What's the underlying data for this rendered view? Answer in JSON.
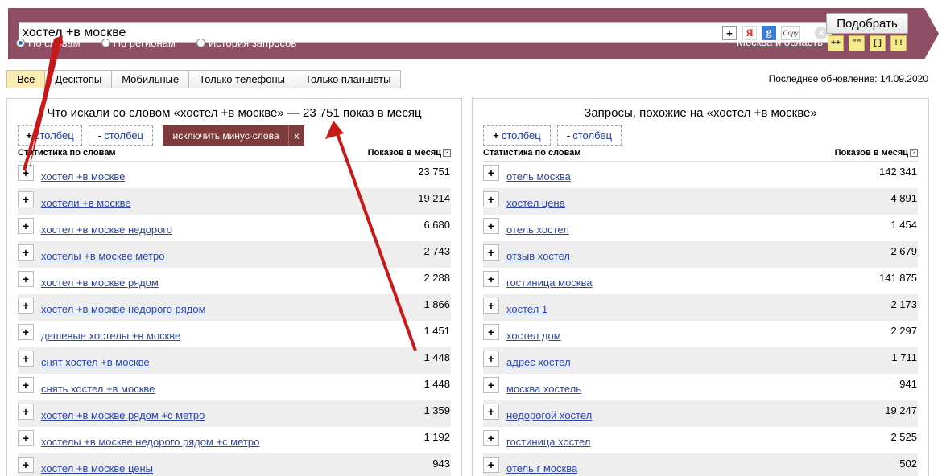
{
  "search": {
    "query": "хостел +в москве",
    "submit_label": "Подобрать",
    "ya_label": "Я",
    "g_label": "g",
    "copy_label": "Copy",
    "add_label": "+"
  },
  "modes": {
    "by_words": "По словам",
    "by_regions": "По регионам",
    "history": "История запросов"
  },
  "region": "Москва и область",
  "operators": [
    "++",
    "\"\"",
    "[]",
    "!!"
  ],
  "tabs": [
    "Все",
    "Десктопы",
    "Мобильные",
    "Только телефоны",
    "Только планшеты"
  ],
  "last_update": "Последнее обновление: 14.09.2020",
  "left": {
    "title": "Что искали со словом «хостел +в москве» — 23 751 показ в месяц",
    "add_col": "столбец",
    "remove_col": "столбец",
    "exclude_btn": "исключить минус-слова",
    "close_btn": "x",
    "col_words": "Статистика по словам",
    "col_shows": "Показов в месяц",
    "rows": [
      {
        "kw": "хостел +в москве",
        "count": "23 751"
      },
      {
        "kw": "хостели +в москве",
        "count": "19 214"
      },
      {
        "kw": "хостел +в москве недорого",
        "count": "6 680"
      },
      {
        "kw": "хостелы +в москве метро",
        "count": "2 743"
      },
      {
        "kw": "хостел +в москве рядом",
        "count": "2 288"
      },
      {
        "kw": "хостел +в москве недорого рядом",
        "count": "1 866"
      },
      {
        "kw": "дешевые хостелы +в москве",
        "count": "1 451"
      },
      {
        "kw": "снят хостел +в москве",
        "count": "1 448"
      },
      {
        "kw": "снять хостел +в москве",
        "count": "1 448"
      },
      {
        "kw": "хостел +в москве рядом +с метро",
        "count": "1 359"
      },
      {
        "kw": "хостелы +в москве недорого рядом +с метро",
        "count": "1 192"
      },
      {
        "kw": "хостел +в москве цены",
        "count": "943"
      }
    ]
  },
  "right": {
    "title": "Запросы, похожие на «хостел +в москве»",
    "add_col": "столбец",
    "remove_col": "столбец",
    "col_words": "Статистика по словам",
    "col_shows": "Показов в месяц",
    "rows": [
      {
        "kw": "отель москва",
        "count": "142 341"
      },
      {
        "kw": "хостел цена",
        "count": "4 891"
      },
      {
        "kw": "отель хостел",
        "count": "1 454"
      },
      {
        "kw": "отзыв хостел",
        "count": "2 679"
      },
      {
        "kw": "гостиница москва",
        "count": "141 875"
      },
      {
        "kw": "хостел 1",
        "count": "2 173"
      },
      {
        "kw": "хостел дом",
        "count": "2 297"
      },
      {
        "kw": "адрес хостел",
        "count": "1 711"
      },
      {
        "kw": "москва хостель",
        "count": "941"
      },
      {
        "kw": "недорогой хостел",
        "count": "19 247"
      },
      {
        "kw": "гостиница хостел",
        "count": "2 525"
      },
      {
        "kw": "отель г москва",
        "count": "502"
      }
    ]
  },
  "colors": {
    "header_bg": "#8e4f66",
    "accent_dark": "#7d3b3b",
    "link": "#2b46a8",
    "arrow": "#c81818"
  }
}
